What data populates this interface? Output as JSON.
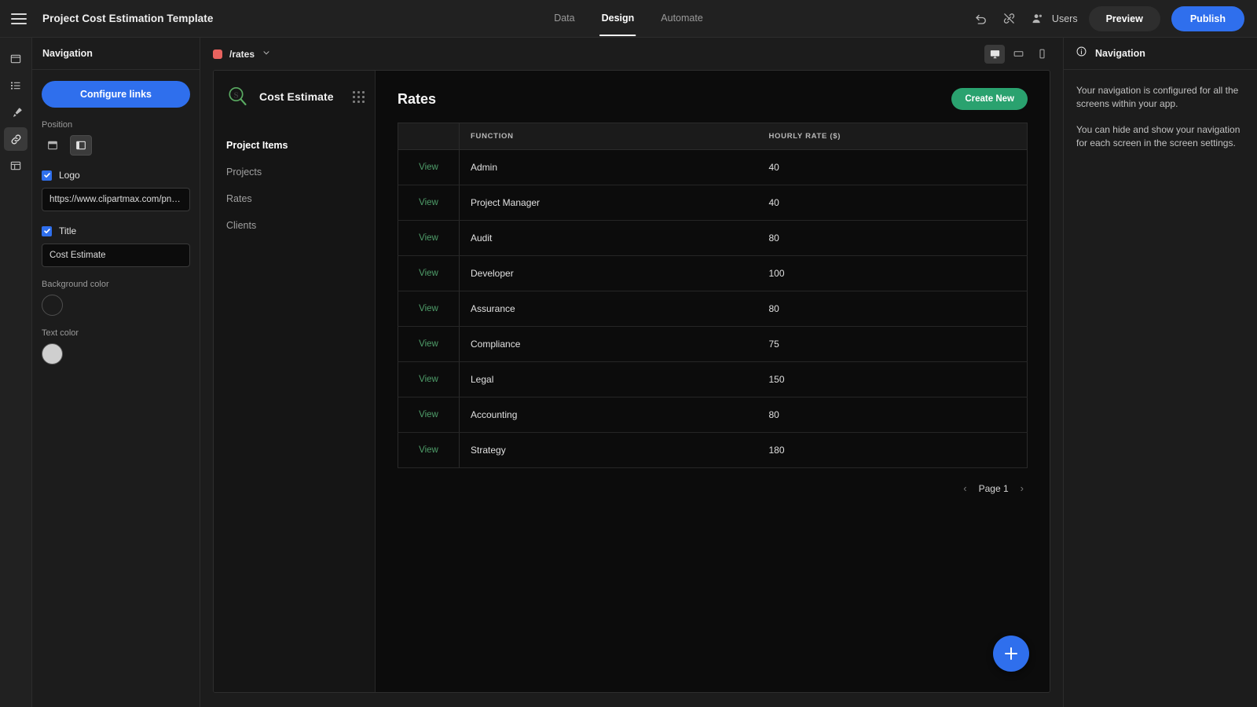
{
  "topbar": {
    "menu_icon": "hamburger-icon",
    "app_title": "Project Cost Estimation Template",
    "tabs": [
      {
        "label": "Data",
        "active": false
      },
      {
        "label": "Design",
        "active": true
      },
      {
        "label": "Automate",
        "active": false
      }
    ],
    "undo_icon": "undo-icon",
    "unlink_icon": "unlink-icon",
    "users_icon": "users-icon",
    "users_label": "Users",
    "preview_label": "Preview",
    "publish_label": "Publish",
    "publish_color": "#2f6fed"
  },
  "rail": {
    "items": [
      {
        "name": "screens-icon",
        "active": false
      },
      {
        "name": "list-icon",
        "active": false
      },
      {
        "name": "theme-brush-icon",
        "active": false
      },
      {
        "name": "navigation-link-icon",
        "active": true
      },
      {
        "name": "components-layout-icon",
        "active": false
      }
    ]
  },
  "nav_panel": {
    "header": "Navigation",
    "configure_links_label": "Configure links",
    "position_label": "Position",
    "position_options": [
      {
        "name": "position-top-icon",
        "active": false
      },
      {
        "name": "position-side-icon",
        "active": true
      }
    ],
    "logo": {
      "label": "Logo",
      "checked": true,
      "url_value": "https://www.clipartmax.com/pn…"
    },
    "title": {
      "label": "Title",
      "checked": true,
      "value": "Cost Estimate"
    },
    "background_color_label": "Background color",
    "background_color_value": "#1c1c1c",
    "text_color_label": "Text color",
    "text_color_value": "#cfcfcf"
  },
  "canvas_bar": {
    "route_dot_color": "#e8635f",
    "route": "/rates",
    "chevron": "⌄",
    "devices": [
      {
        "name": "desktop-icon",
        "active": true
      },
      {
        "name": "tablet-icon",
        "active": false
      },
      {
        "name": "mobile-icon",
        "active": false
      }
    ]
  },
  "preview": {
    "app_nav": {
      "logo_icon": "magnifier-s-logo-icon",
      "brand": "Cost Estimate",
      "grip_icon": "drag-grip-icon",
      "links": [
        {
          "label": "Project Items",
          "active": true
        },
        {
          "label": "Projects",
          "active": false
        },
        {
          "label": "Rates",
          "active": false
        },
        {
          "label": "Clients",
          "active": false
        }
      ]
    },
    "page_title": "Rates",
    "create_new_label": "Create New",
    "create_new_color": "#2aa26f",
    "table": {
      "columns": [
        "",
        "FUNCTION",
        "HOURLY RATE ($)"
      ],
      "action_label": "View",
      "rows": [
        {
          "function": "Admin",
          "hourly_rate": "40"
        },
        {
          "function": "Project Manager",
          "hourly_rate": "40"
        },
        {
          "function": "Audit",
          "hourly_rate": "80"
        },
        {
          "function": "Developer",
          "hourly_rate": "100"
        },
        {
          "function": "Assurance",
          "hourly_rate": "80"
        },
        {
          "function": "Compliance",
          "hourly_rate": "75"
        },
        {
          "function": "Legal",
          "hourly_rate": "150"
        },
        {
          "function": "Accounting",
          "hourly_rate": "80"
        },
        {
          "function": "Strategy",
          "hourly_rate": "180"
        }
      ]
    },
    "pagination": {
      "prev": "‹",
      "label": "Page 1",
      "next": "›"
    },
    "fab_icon": "add-plus-icon"
  },
  "right_panel": {
    "info_icon": "info-icon",
    "header": "Navigation",
    "paragraph_1": "Your navigation is configured for all the screens within your app.",
    "paragraph_2": "You can hide and show your navigation for each screen in the screen settings."
  }
}
